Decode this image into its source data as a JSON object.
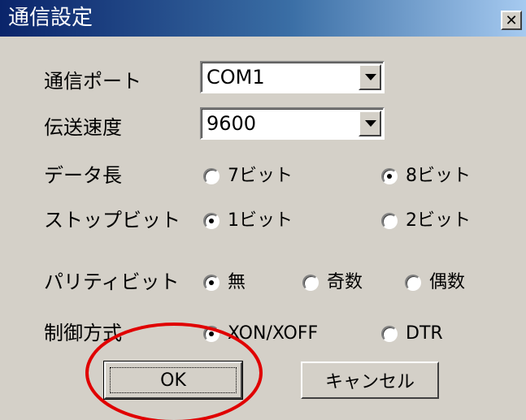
{
  "window": {
    "title": "通信設定",
    "close_glyph": "✕"
  },
  "form": {
    "port": {
      "label": "通信ポート",
      "value": "COM1"
    },
    "baud": {
      "label": "伝送速度",
      "value": "9600"
    },
    "data_length": {
      "label": "データ長",
      "options": [
        {
          "label": "7ビット",
          "checked": false
        },
        {
          "label": "8ビット",
          "checked": true
        }
      ]
    },
    "stop_bits": {
      "label": "ストップビット",
      "options": [
        {
          "label": "1ビット",
          "checked": true
        },
        {
          "label": "2ビット",
          "checked": false
        }
      ]
    },
    "parity": {
      "label": "パリティビット",
      "options": [
        {
          "label": "無",
          "checked": true
        },
        {
          "label": "奇数",
          "checked": false
        },
        {
          "label": "偶数",
          "checked": false
        }
      ]
    },
    "flow_control": {
      "label": "制御方式",
      "options": [
        {
          "label": "XON/XOFF",
          "checked": true
        },
        {
          "label": "DTR",
          "checked": false
        }
      ]
    }
  },
  "buttons": {
    "ok": "OK",
    "cancel": "キャンセル"
  },
  "colors": {
    "dialog_bg": "#d4d0c8",
    "highlight": "#e00000"
  }
}
